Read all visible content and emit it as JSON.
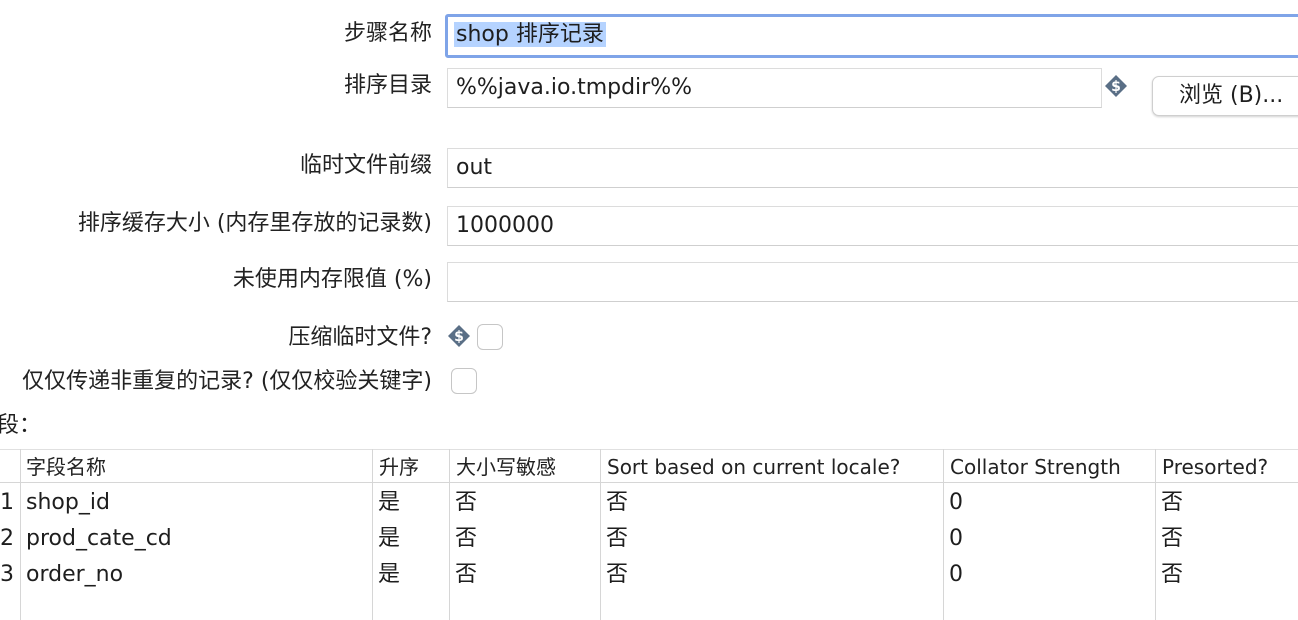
{
  "form": {
    "step_name_label": "步骤名称",
    "step_name_value": "shop 排序记录",
    "sort_dir_label": "排序目录",
    "sort_dir_value": "%%java.io.tmpdir%%",
    "browse_label": "浏览 (B)...",
    "temp_prefix_label": "临时文件前缀",
    "temp_prefix_value": "out",
    "sort_buffer_label": "排序缓存大小 (内存里存放的记录数)",
    "sort_buffer_value": "1000000",
    "free_memory_label": "未使用内存限值 (%)",
    "free_memory_value": "",
    "compress_label": "压缩临时文件?",
    "compress_checked": false,
    "unique_label": "仅仅传递非重复的记录? (仅仅校验关键字)",
    "unique_checked": false,
    "fields_section_label": "段："
  },
  "icons": {
    "variable_icon": "dollar-diamond-icon"
  },
  "colors": {
    "focus_border": "#7fa4e8",
    "selection": "#b5d3ff",
    "variable_icon": "#5a6f86"
  },
  "table": {
    "headers": [
      "字段名称",
      "升序",
      "大小写敏感",
      "Sort based on current locale?",
      "Collator Strength",
      "Presorted?"
    ],
    "rows": [
      {
        "num": "1",
        "cells": [
          "shop_id",
          "是",
          "否",
          "否",
          "0",
          "否"
        ]
      },
      {
        "num": "2",
        "cells": [
          "prod_cate_cd",
          "是",
          "否",
          "否",
          "0",
          "否"
        ]
      },
      {
        "num": "3",
        "cells": [
          "order_no",
          "是",
          "否",
          "否",
          "0",
          "否"
        ]
      }
    ]
  }
}
